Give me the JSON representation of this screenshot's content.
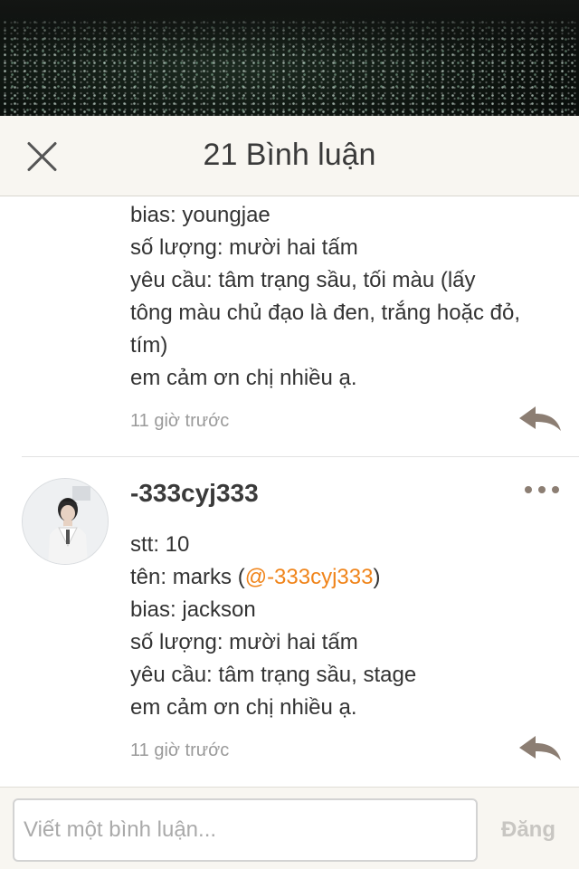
{
  "header": {
    "title": "21 Bình luận",
    "close_icon": "close-icon"
  },
  "comments": [
    {
      "lines": [
        "bias: youngjae",
        "số lượng: mười hai tấm",
        "yêu cầu: tâm trạng sầu, tối màu (lấy",
        "tông màu chủ đạo là đen, trắng hoặc đỏ,",
        "tím)",
        "em cảm ơn chị nhiều ạ."
      ],
      "time": "11 giờ trước",
      "reply_icon": "reply-icon"
    },
    {
      "username": "-333cyj333",
      "avatar_icon": "avatar",
      "more_icon": "more-icon",
      "line1": "stt: 10",
      "line2_prefix": "tên: marks (",
      "line2_mention": "@-333cyj333",
      "line2_suffix": ")",
      "line3": "bias: jackson",
      "line4": "số lượng: mười hai tấm",
      "line5": "yêu cầu: tâm trạng sầu, stage",
      "line6": "em cảm ơn chị nhiều ạ.",
      "time": "11 giờ trước",
      "reply_icon": "reply-icon"
    }
  ],
  "footer": {
    "input_placeholder": "Viết một bình luận...",
    "post_label": "Đăng"
  },
  "colors": {
    "accent_mention": "#f0841a",
    "header_bg": "#f8f6f1",
    "icon_gray": "#8c7e73"
  }
}
